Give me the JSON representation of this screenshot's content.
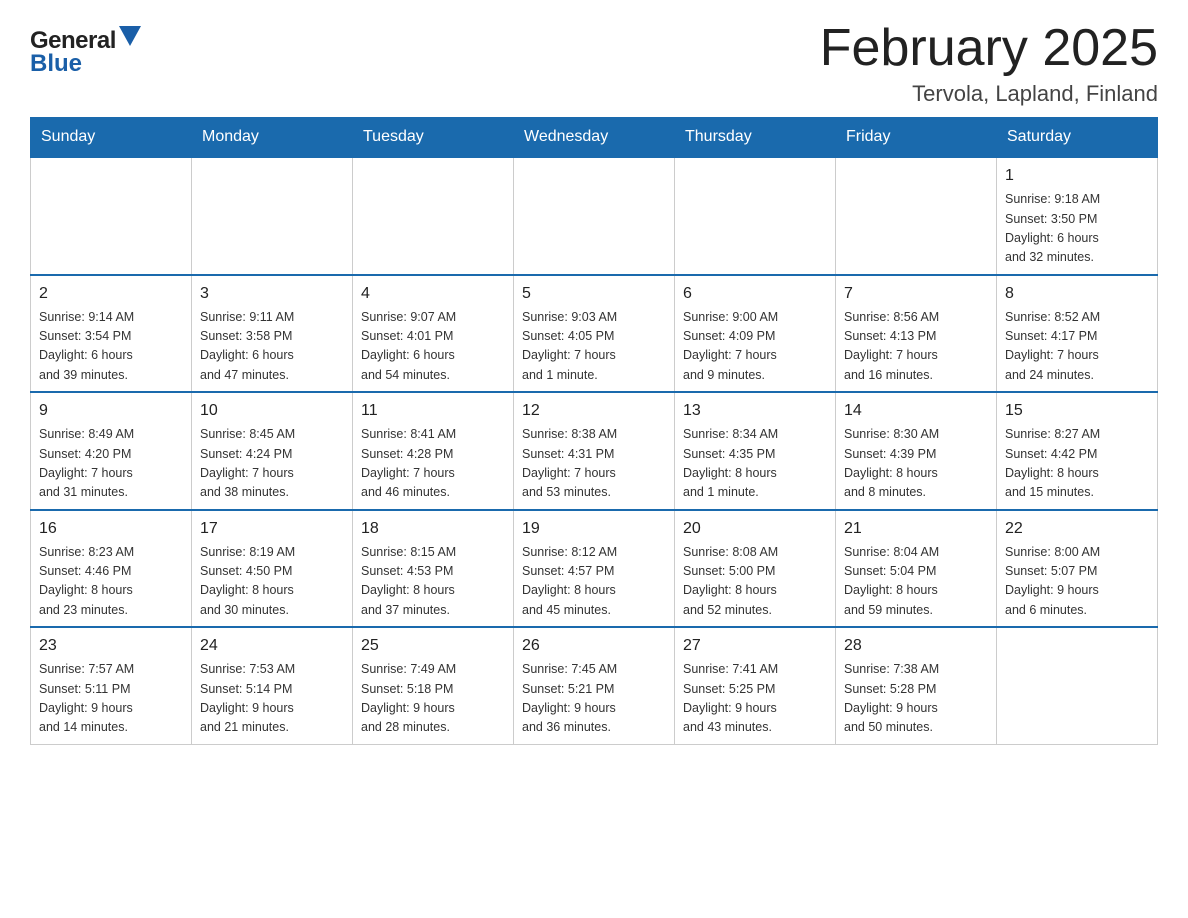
{
  "logo": {
    "general_text": "General",
    "blue_text": "Blue",
    "arrow_color": "#1a5fa8"
  },
  "header": {
    "title": "February 2025",
    "subtitle": "Tervola, Lapland, Finland"
  },
  "weekdays": [
    "Sunday",
    "Monday",
    "Tuesday",
    "Wednesday",
    "Thursday",
    "Friday",
    "Saturday"
  ],
  "weeks": [
    {
      "days": [
        {
          "number": "",
          "info": "",
          "empty": true
        },
        {
          "number": "",
          "info": "",
          "empty": true
        },
        {
          "number": "",
          "info": "",
          "empty": true
        },
        {
          "number": "",
          "info": "",
          "empty": true
        },
        {
          "number": "",
          "info": "",
          "empty": true
        },
        {
          "number": "",
          "info": "",
          "empty": true
        },
        {
          "number": "1",
          "info": "Sunrise: 9:18 AM\nSunset: 3:50 PM\nDaylight: 6 hours\nand 32 minutes.",
          "empty": false
        }
      ]
    },
    {
      "days": [
        {
          "number": "2",
          "info": "Sunrise: 9:14 AM\nSunset: 3:54 PM\nDaylight: 6 hours\nand 39 minutes.",
          "empty": false
        },
        {
          "number": "3",
          "info": "Sunrise: 9:11 AM\nSunset: 3:58 PM\nDaylight: 6 hours\nand 47 minutes.",
          "empty": false
        },
        {
          "number": "4",
          "info": "Sunrise: 9:07 AM\nSunset: 4:01 PM\nDaylight: 6 hours\nand 54 minutes.",
          "empty": false
        },
        {
          "number": "5",
          "info": "Sunrise: 9:03 AM\nSunset: 4:05 PM\nDaylight: 7 hours\nand 1 minute.",
          "empty": false
        },
        {
          "number": "6",
          "info": "Sunrise: 9:00 AM\nSunset: 4:09 PM\nDaylight: 7 hours\nand 9 minutes.",
          "empty": false
        },
        {
          "number": "7",
          "info": "Sunrise: 8:56 AM\nSunset: 4:13 PM\nDaylight: 7 hours\nand 16 minutes.",
          "empty": false
        },
        {
          "number": "8",
          "info": "Sunrise: 8:52 AM\nSunset: 4:17 PM\nDaylight: 7 hours\nand 24 minutes.",
          "empty": false
        }
      ]
    },
    {
      "days": [
        {
          "number": "9",
          "info": "Sunrise: 8:49 AM\nSunset: 4:20 PM\nDaylight: 7 hours\nand 31 minutes.",
          "empty": false
        },
        {
          "number": "10",
          "info": "Sunrise: 8:45 AM\nSunset: 4:24 PM\nDaylight: 7 hours\nand 38 minutes.",
          "empty": false
        },
        {
          "number": "11",
          "info": "Sunrise: 8:41 AM\nSunset: 4:28 PM\nDaylight: 7 hours\nand 46 minutes.",
          "empty": false
        },
        {
          "number": "12",
          "info": "Sunrise: 8:38 AM\nSunset: 4:31 PM\nDaylight: 7 hours\nand 53 minutes.",
          "empty": false
        },
        {
          "number": "13",
          "info": "Sunrise: 8:34 AM\nSunset: 4:35 PM\nDaylight: 8 hours\nand 1 minute.",
          "empty": false
        },
        {
          "number": "14",
          "info": "Sunrise: 8:30 AM\nSunset: 4:39 PM\nDaylight: 8 hours\nand 8 minutes.",
          "empty": false
        },
        {
          "number": "15",
          "info": "Sunrise: 8:27 AM\nSunset: 4:42 PM\nDaylight: 8 hours\nand 15 minutes.",
          "empty": false
        }
      ]
    },
    {
      "days": [
        {
          "number": "16",
          "info": "Sunrise: 8:23 AM\nSunset: 4:46 PM\nDaylight: 8 hours\nand 23 minutes.",
          "empty": false
        },
        {
          "number": "17",
          "info": "Sunrise: 8:19 AM\nSunset: 4:50 PM\nDaylight: 8 hours\nand 30 minutes.",
          "empty": false
        },
        {
          "number": "18",
          "info": "Sunrise: 8:15 AM\nSunset: 4:53 PM\nDaylight: 8 hours\nand 37 minutes.",
          "empty": false
        },
        {
          "number": "19",
          "info": "Sunrise: 8:12 AM\nSunset: 4:57 PM\nDaylight: 8 hours\nand 45 minutes.",
          "empty": false
        },
        {
          "number": "20",
          "info": "Sunrise: 8:08 AM\nSunset: 5:00 PM\nDaylight: 8 hours\nand 52 minutes.",
          "empty": false
        },
        {
          "number": "21",
          "info": "Sunrise: 8:04 AM\nSunset: 5:04 PM\nDaylight: 8 hours\nand 59 minutes.",
          "empty": false
        },
        {
          "number": "22",
          "info": "Sunrise: 8:00 AM\nSunset: 5:07 PM\nDaylight: 9 hours\nand 6 minutes.",
          "empty": false
        }
      ]
    },
    {
      "days": [
        {
          "number": "23",
          "info": "Sunrise: 7:57 AM\nSunset: 5:11 PM\nDaylight: 9 hours\nand 14 minutes.",
          "empty": false
        },
        {
          "number": "24",
          "info": "Sunrise: 7:53 AM\nSunset: 5:14 PM\nDaylight: 9 hours\nand 21 minutes.",
          "empty": false
        },
        {
          "number": "25",
          "info": "Sunrise: 7:49 AM\nSunset: 5:18 PM\nDaylight: 9 hours\nand 28 minutes.",
          "empty": false
        },
        {
          "number": "26",
          "info": "Sunrise: 7:45 AM\nSunset: 5:21 PM\nDaylight: 9 hours\nand 36 minutes.",
          "empty": false
        },
        {
          "number": "27",
          "info": "Sunrise: 7:41 AM\nSunset: 5:25 PM\nDaylight: 9 hours\nand 43 minutes.",
          "empty": false
        },
        {
          "number": "28",
          "info": "Sunrise: 7:38 AM\nSunset: 5:28 PM\nDaylight: 9 hours\nand 50 minutes.",
          "empty": false
        },
        {
          "number": "",
          "info": "",
          "empty": true
        }
      ]
    }
  ]
}
